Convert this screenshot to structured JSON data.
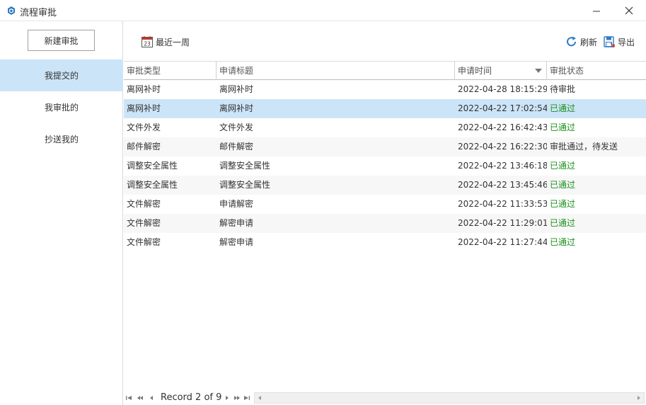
{
  "window": {
    "title": "流程审批",
    "minimize_glyph": "—",
    "close_glyph": "✕"
  },
  "sidebar": {
    "new_button": "新建审批",
    "items": [
      {
        "label": "我提交的",
        "active": true
      },
      {
        "label": "我审批的",
        "active": false
      },
      {
        "label": "抄送我的",
        "active": false
      }
    ]
  },
  "toolbar": {
    "date_filter": {
      "label": "最近一周",
      "icon": "calendar-icon",
      "icon_number": "23"
    },
    "refresh": {
      "label": "刷新",
      "icon": "refresh-icon"
    },
    "export": {
      "label": "导出",
      "icon": "export-icon"
    }
  },
  "table": {
    "columns": [
      "审批类型",
      "申请标题",
      "申请时间",
      "审批状态"
    ],
    "sort_column": "申请时间",
    "sort_direction": "descending",
    "rows": [
      {
        "type": "离网补时",
        "title": "离网补时",
        "time": "2022-04-28 18:15:29",
        "status": "待审批",
        "approved": false
      },
      {
        "type": "离网补时",
        "title": "离网补时",
        "time": "2022-04-22 17:02:54",
        "status": "已通过",
        "approved": true
      },
      {
        "type": "文件外发",
        "title": "文件外发",
        "time": "2022-04-22 16:42:43",
        "status": "已通过",
        "approved": true
      },
      {
        "type": "邮件解密",
        "title": "邮件解密",
        "time": "2022-04-22 16:22:30",
        "status": "审批通过，待发送",
        "approved": false
      },
      {
        "type": "调整安全属性",
        "title": "调整安全属性",
        "time": "2022-04-22 13:46:18",
        "status": "已通过",
        "approved": true
      },
      {
        "type": "调整安全属性",
        "title": "调整安全属性",
        "time": "2022-04-22 13:45:46",
        "status": "已通过",
        "approved": true
      },
      {
        "type": "文件解密",
        "title": "申请解密",
        "time": "2022-04-22 11:33:53",
        "status": "已通过",
        "approved": true
      },
      {
        "type": "文件解密",
        "title": "解密申请",
        "time": "2022-04-22 11:29:01",
        "status": "已通过",
        "approved": true
      },
      {
        "type": "文件解密",
        "title": "解密申请",
        "time": "2022-04-22 11:27:44",
        "status": "已通过",
        "approved": true
      }
    ],
    "selected_row": 1
  },
  "navigator": {
    "record_text": "Record 2 of 9"
  },
  "colors": {
    "selection": "#cce4f7",
    "approved_status": "#1a8f1a",
    "accent": "#2e7ac4"
  }
}
